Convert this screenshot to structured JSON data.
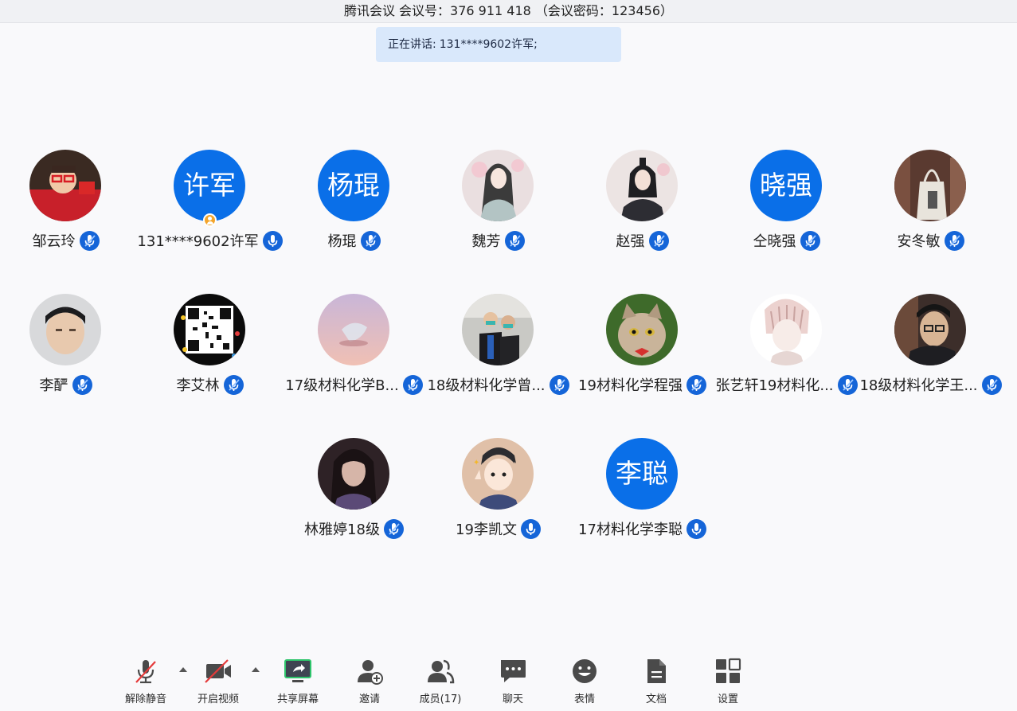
{
  "window": {
    "title": "腾讯会议 会议号：376 911 418 （会议密码：123456）"
  },
  "speaking_banner": {
    "prefix": "正在讲话:",
    "speaker": "131****9602许军;"
  },
  "participants": [
    {
      "name": "邹云玲",
      "avatar_type": "photo",
      "avatar": "child-red-glasses"
    },
    {
      "name": "131****9602许军",
      "avatar_type": "text",
      "avatar_text": "许军",
      "host": true,
      "mic": "on"
    },
    {
      "name": "杨琨",
      "avatar_type": "text",
      "avatar_text": "杨琨"
    },
    {
      "name": "魏芳",
      "avatar_type": "photo",
      "avatar": "painted-woman"
    },
    {
      "name": "赵强",
      "avatar_type": "photo",
      "avatar": "painted-man"
    },
    {
      "name": "仝晓强",
      "avatar_type": "text",
      "avatar_text": "晓强"
    },
    {
      "name": "安冬敏",
      "avatar_type": "photo",
      "avatar": "tote-bag"
    },
    {
      "name": "李酽",
      "avatar_type": "photo",
      "avatar": "man-face"
    },
    {
      "name": "李艾林",
      "avatar_type": "photo",
      "avatar": "qr-code"
    },
    {
      "name": "17级材料化学B...",
      "avatar_type": "photo",
      "avatar": "pink-sky"
    },
    {
      "name": "18级材料化学曾...",
      "avatar_type": "photo",
      "avatar": "two-people"
    },
    {
      "name": "19材料化学程强",
      "avatar_type": "photo",
      "avatar": "cat"
    },
    {
      "name": "张艺轩19材料化...",
      "avatar_type": "photo",
      "avatar": "anime-sketch"
    },
    {
      "name": "18级材料化学王...",
      "avatar_type": "photo",
      "avatar": "man-glasses"
    },
    {
      "name": "林雅婷18级",
      "avatar_type": "photo",
      "avatar": "dark-girl"
    },
    {
      "name": "19李凯文",
      "avatar_type": "photo",
      "avatar": "cartoon-boy",
      "mic": "on"
    },
    {
      "name": "17材料化学李聪",
      "avatar_type": "text",
      "avatar_text": "李聪",
      "mic": "on"
    }
  ],
  "toolbar": [
    {
      "label": "解除静音",
      "icon": "mic-muted-icon"
    },
    {
      "label": "开启视频",
      "icon": "video-off-icon"
    },
    {
      "label": "共享屏幕",
      "icon": "share-screen-icon"
    },
    {
      "label": "邀请",
      "icon": "invite-icon"
    },
    {
      "label": "成员(17)",
      "icon": "members-icon"
    },
    {
      "label": "聊天",
      "icon": "chat-icon"
    },
    {
      "label": "表情",
      "icon": "emoji-icon"
    },
    {
      "label": "文档",
      "icon": "document-icon"
    },
    {
      "label": "设置",
      "icon": "settings-icon"
    }
  ],
  "colors": {
    "accent": "#0a6fe8",
    "mic_badge": "#1565d8",
    "banner": "#d9e8fb",
    "host_badge": "#f4a52b"
  }
}
